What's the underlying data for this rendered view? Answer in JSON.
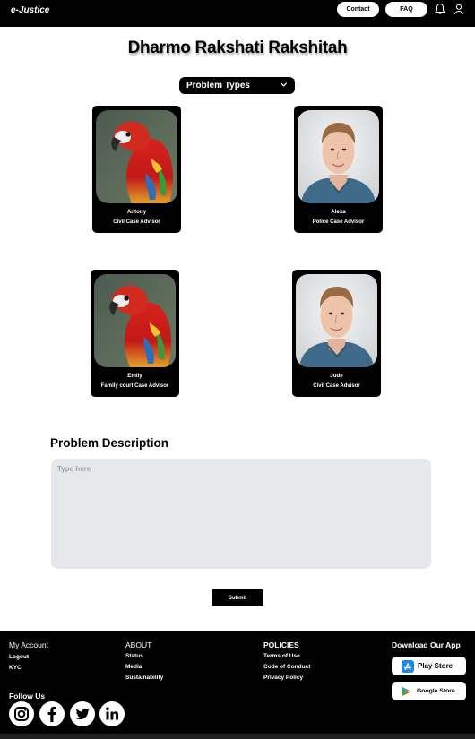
{
  "header": {
    "logo": "e-Justice",
    "contact_label": "Contact",
    "faq_label": "FAQ"
  },
  "main": {
    "title": "Dharmo Rakshati Rakshitah",
    "dropdown_label": "Problem Types",
    "advisors": [
      {
        "name": "Antony",
        "role": "Civil Case Advisor",
        "photo": "parrot"
      },
      {
        "name": "Alexa",
        "role": "Police Case Advisor",
        "photo": "man-portrait"
      },
      {
        "name": "Emily",
        "role": "Family court Case Advisor",
        "photo": "parrot"
      },
      {
        "name": "Jude",
        "role": "Civil Case Advisor",
        "photo": "man-portrait"
      }
    ],
    "description_title": "Problem Description",
    "description_placeholder": "Type here",
    "description_value": "",
    "submit_label": "Submit"
  },
  "footer": {
    "my_account": {
      "title": "My Account",
      "links": [
        "Logout",
        "KYC"
      ]
    },
    "about": {
      "title": "ABOUT",
      "links": [
        "Status",
        "Media",
        "Sustainability"
      ]
    },
    "policies": {
      "title": "POLICIES",
      "links": [
        "Terms of Use",
        "Code of Conduct",
        "Privacy Policy"
      ]
    },
    "download": {
      "title": "Download Our App",
      "play_store": "Play Store",
      "google_store": "Google Store"
    },
    "follow_us": "Follow Us",
    "social_icons": [
      "instagram-icon",
      "facebook-icon",
      "twitter-icon",
      "linkedin-icon"
    ]
  },
  "colors": {
    "bar": "#000000",
    "textarea_bg": "#e5e7eb",
    "placeholder": "#9ca3af"
  }
}
